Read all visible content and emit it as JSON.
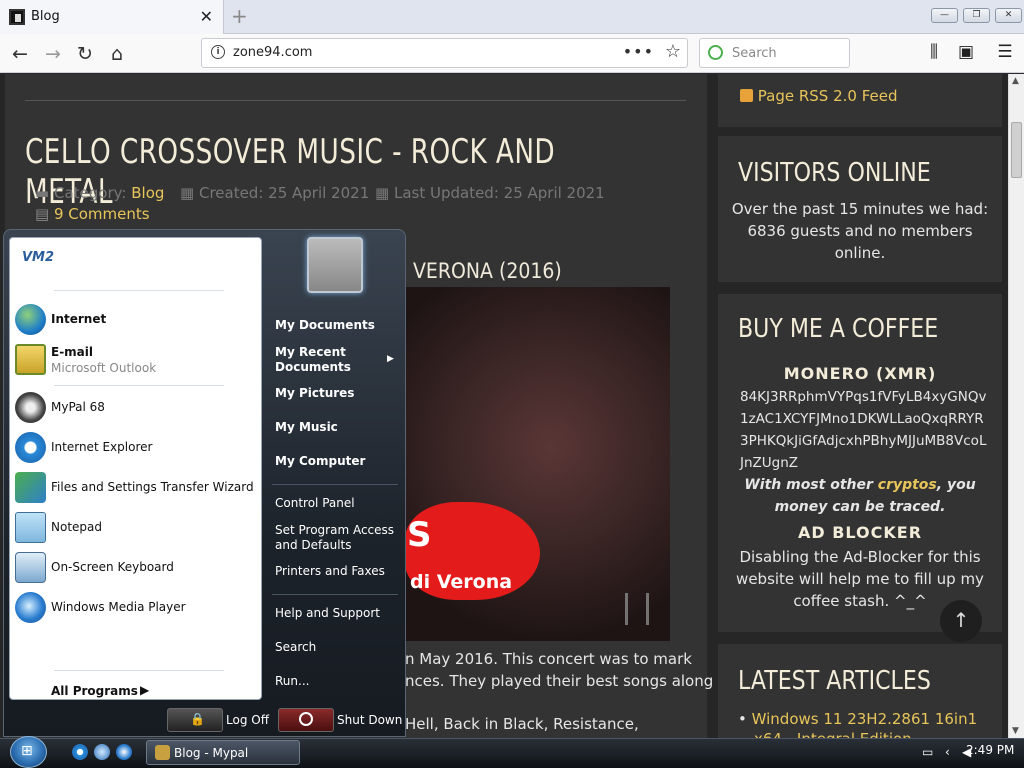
{
  "browser": {
    "tab_title": "Blog",
    "url": "zone94.com",
    "search_placeholder": "Search",
    "page_actions": "•••"
  },
  "article": {
    "title": "CELLO CROSSOVER MUSIC - ROCK AND METAL",
    "category_label": "Category:",
    "category_value": "Blog",
    "created": "Created: 25 April 2021",
    "updated": "Last Updated: 25 April 2021",
    "comments": "9 Comments",
    "subheading": "VERONA (2016)",
    "image_text_big": "S",
    "image_text_small": "di Verona",
    "body_line1": "n May 2016. This concert was to mark",
    "body_line2": "nces. They played their best songs along",
    "body_line3": "Hell, Back in Black, Resistance,"
  },
  "sidebar": {
    "rss": "Page RSS 2.0 Feed",
    "visitors_title": "VISITORS ONLINE",
    "visitors_line1": "Over the past 15 minutes we had:",
    "visitors_line2": "6836 guests and no members",
    "visitors_line3": "online.",
    "coffee_title": "BUY ME A COFFEE",
    "monero_heading": "MONERO (XMR)",
    "monero_address": "84KJ3RRphmVYPqs1fVFyLB4xyGNQv1zAC1XCYFJMno1DKWLLaoQxqRRYR3PHKQkJiGfAdjcxhPBhyMJJuMB8VcoLJnZUgnZ",
    "cryptos_pre": "With most other ",
    "cryptos_link": "cryptos",
    "cryptos_post": ", you",
    "cryptos_line2": "money can be traced.",
    "adblock_heading": "AD BLOCKER",
    "adblock_line1": "Disabling the Ad-Blocker for this",
    "adblock_line2": "website will help me to fill up my",
    "adblock_line3": "coffee stash. ^_^",
    "latest_title": "LATEST ARTICLES",
    "latest_item1": "Windows 11 23H2.2861 16in1",
    "latest_item1b": "x64 - Integral Edition"
  },
  "startmenu": {
    "logo": "VM2",
    "pinned": [
      {
        "label": "Internet",
        "icon": "globe-icon"
      },
      {
        "label": "E-mail",
        "sub": "Microsoft Outlook",
        "icon": "outlook-icon"
      }
    ],
    "recent": [
      {
        "label": "MyPal 68",
        "icon": "mypal-icon"
      },
      {
        "label": "Internet Explorer",
        "icon": "ie-icon"
      },
      {
        "label": "Files and Settings Transfer Wizard",
        "icon": "transfer-icon"
      },
      {
        "label": "Notepad",
        "icon": "notepad-icon"
      },
      {
        "label": "On-Screen Keyboard",
        "icon": "keyboard-icon"
      },
      {
        "label": "Windows Media Player",
        "icon": "media-player-icon"
      }
    ],
    "all_programs": "All Programs",
    "right": {
      "my_documents": "My Documents",
      "my_recent_1": "My Recent",
      "my_recent_2": "Documents",
      "my_pictures": "My Pictures",
      "my_music": "My Music",
      "my_computer": "My Computer",
      "control_panel": "Control Panel",
      "set_program_1": "Set Program Access",
      "set_program_2": "and Defaults",
      "printers": "Printers and Faxes",
      "help": "Help and Support",
      "search": "Search",
      "run": "Run..."
    },
    "log_off": "Log Off",
    "shut_down": "Shut Down"
  },
  "taskbar": {
    "task_label": "Blog - Mypal",
    "time": "2:49 PM"
  }
}
